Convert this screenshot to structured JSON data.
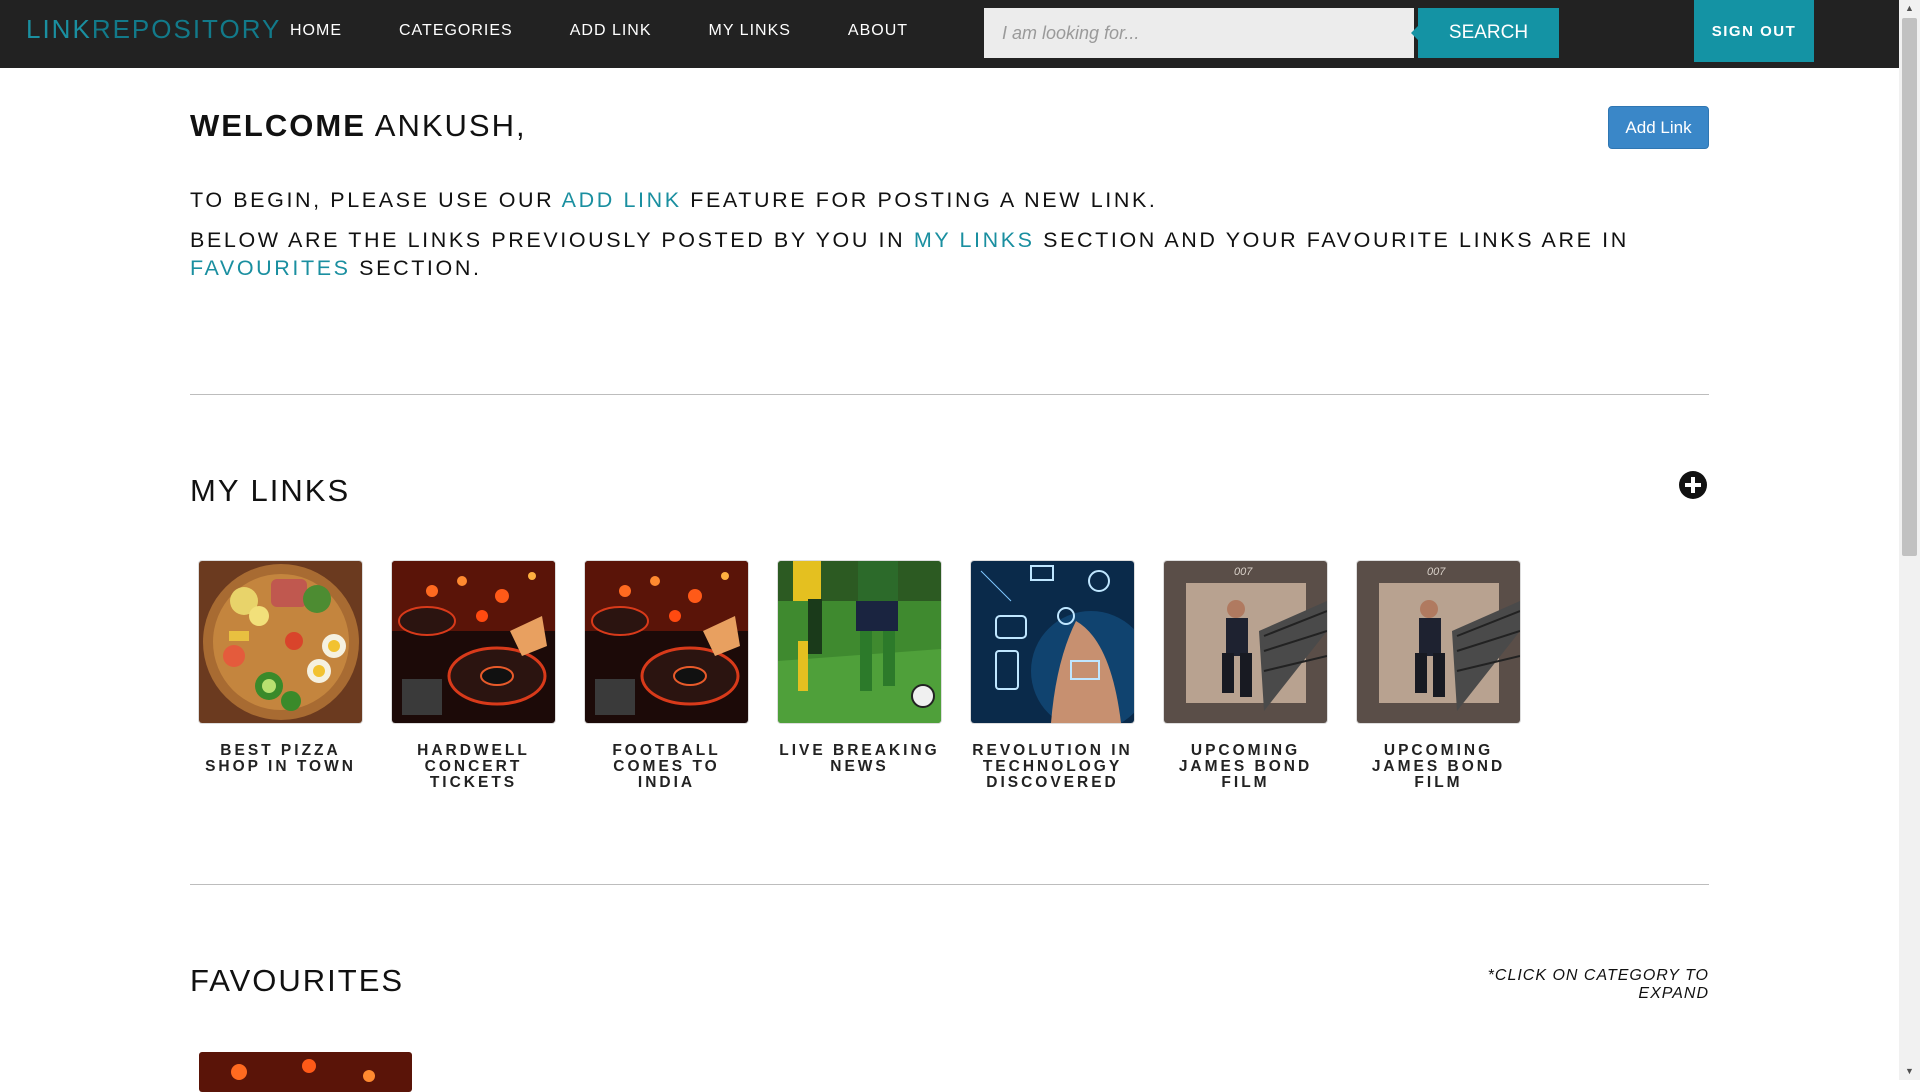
{
  "navbar": {
    "brand_part1": "LINK",
    "brand_part2": "REPOSITORY",
    "links": [
      "HOME",
      "CATEGORIES",
      "ADD LINK",
      "MY LINKS",
      "ABOUT"
    ],
    "search_placeholder": "I am looking for...",
    "search_label": "SEARCH",
    "signout_label": "SIGN OUT"
  },
  "welcome": {
    "greeting": "WELCOME",
    "name": "ANKUSH,",
    "add_link_button": "Add Link"
  },
  "intro": {
    "line1_a": "TO BEGIN, PLEASE USE OUR ",
    "line1_link": "ADD LINK",
    "line1_b": " FEATURE FOR POSTING A NEW LINK.",
    "line2_a": "BELOW ARE THE LINKS PREVIOUSLY POSTED BY YOU IN ",
    "line2_link1": "MY LINKS",
    "line2_b": " SECTION AND YOUR FAVOURITE LINKS ARE IN ",
    "line2_link2": "FAVOURITES",
    "line2_c": " SECTION."
  },
  "my_links": {
    "title": "MY LINKS",
    "items": [
      {
        "title": "BEST PIZZA SHOP IN TOWN",
        "image": "pizza"
      },
      {
        "title": "HARDWELL CONCERT TICKETS",
        "image": "dj-mixer"
      },
      {
        "title": "FOOTBALL COMES TO INDIA",
        "image": "dj-mixer"
      },
      {
        "title": "LIVE BREAKING NEWS",
        "image": "football-players"
      },
      {
        "title": "REVOLUTION IN TECHNOLOGY DISCOVERED",
        "image": "tech-hand"
      },
      {
        "title": "UPCOMING JAMES BOND FILM",
        "image": "james-bond"
      },
      {
        "title": "UPCOMING JAMES BOND FILM",
        "image": "james-bond"
      }
    ]
  },
  "favourites": {
    "title": "FAVOURITES",
    "note": "*CLICK ON CATEGORY TO EXPAND",
    "bond_logo": "007"
  },
  "colors": {
    "accent": "#1493a4",
    "link": "#1a8fa0",
    "navbar_bg": "#222222",
    "button_blue": "#3a87c8"
  }
}
